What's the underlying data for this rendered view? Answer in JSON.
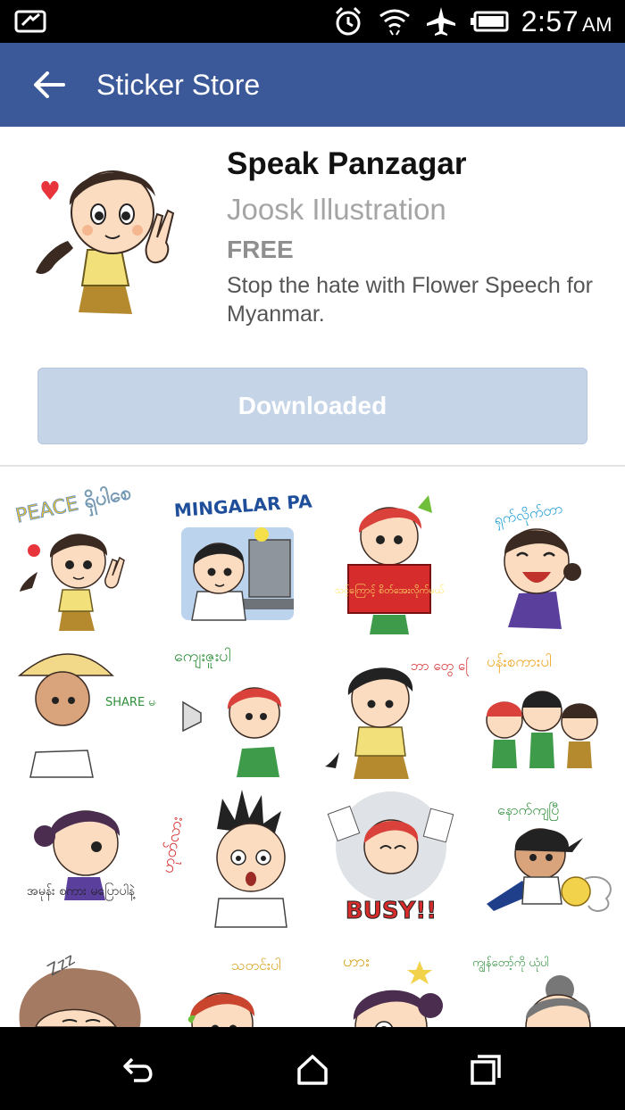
{
  "status_bar": {
    "time": "2:57",
    "ampm": "AM",
    "icons": [
      "notification-icon",
      "alarm-icon",
      "wifi-icon",
      "airplane-mode-icon",
      "battery-icon"
    ]
  },
  "app_bar": {
    "title": "Sticker Store",
    "back_icon": "back-arrow-icon"
  },
  "pack": {
    "title": "Speak Panzagar",
    "author": "Joosk Illustration",
    "price": "FREE",
    "description": "Stop the hate with Flower Speech for Myanmar.",
    "button_label": "Downloaded"
  },
  "stickers": {
    "captions": [
      "PEACE ရှိပါစေ",
      "MINGALAR PAR",
      "သင့်ကြောင့် စိတ်အေးလိုက်မယ်",
      "ရှက်လိုက်တာ",
      "SHARE မလုပ်ခင် စဉ်းစား",
      "ကျေးဇူးပါ",
      "ဘာ တွေ ပြောနေတာလဲ",
      "ပန်းစကားပါ",
      "အမုန်း စကား မပြောပါနဲ့",
      "ဟုတ်လား",
      "BUSY!!",
      "နောက်ကျပြီ",
      "Zzz",
      "သတင်းပါ",
      "ဟား",
      "ကျွန်တော့်ကို ယုံပါ"
    ]
  },
  "nav_bar": {
    "icons": [
      "back-nav-icon",
      "home-nav-icon",
      "recents-nav-icon"
    ]
  },
  "colors": {
    "app_bar": "#3b5998",
    "button_disabled": "#c6d4e8",
    "status_bar": "#000000"
  }
}
